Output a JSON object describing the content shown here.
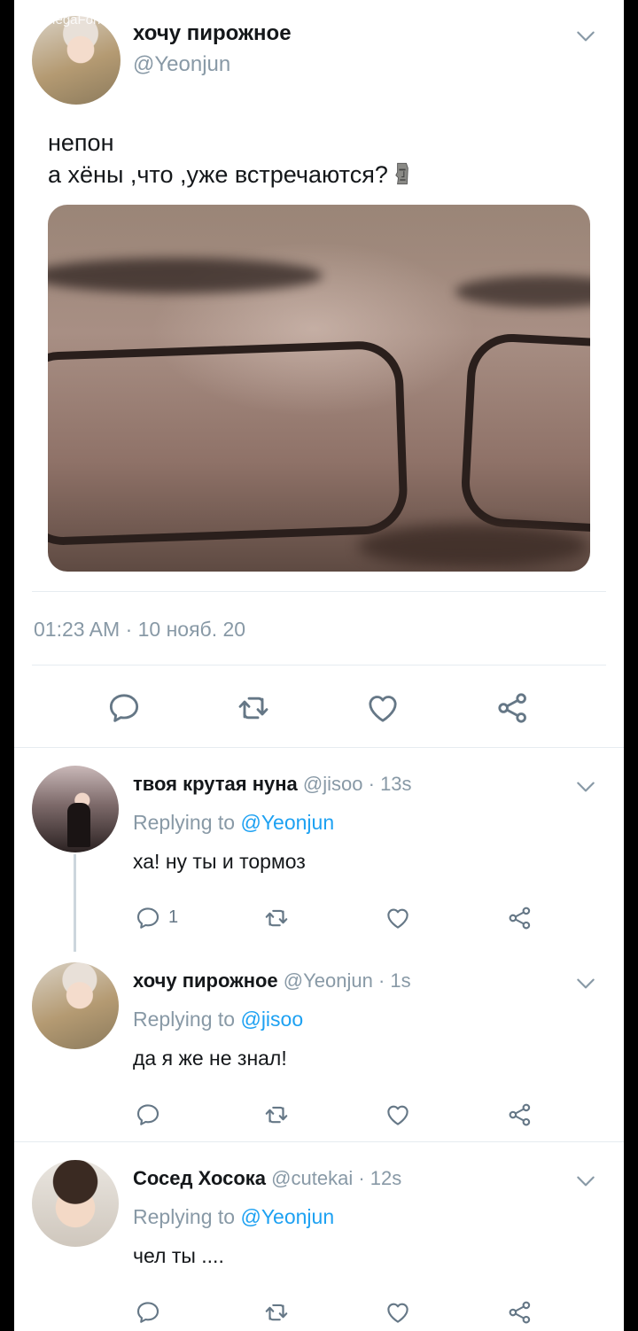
{
  "status_bar": {
    "carrier": "MegaFon"
  },
  "main_tweet": {
    "display_name": "хочу пирожное",
    "handle": "@Yeonjun",
    "text_line1": "непон",
    "text_line2": "а хёны ,что ,уже встречаются?",
    "emoji": "moai",
    "timestamp": "01:23 AM · 10 нояб. 20"
  },
  "replies": [
    {
      "display_name": "твоя крутая нуна",
      "handle": "@jisoo",
      "time": "· 13s",
      "replying_label": "Replying to",
      "replying_to": "@Yeonjun",
      "text": "ха! ну ты и тормоз",
      "reply_count": "1"
    },
    {
      "display_name": "хочу пирожное",
      "handle": "@Yeonjun",
      "time": "· 1s",
      "replying_label": "Replying to",
      "replying_to": "@jisoo",
      "text": "да я же не знал!",
      "reply_count": ""
    },
    {
      "display_name": "Сосед Хосока",
      "handle": "@cutekai",
      "time": "· 12s",
      "replying_label": "Replying to",
      "replying_to": "@Yeonjun",
      "text": "чел ты ....",
      "reply_count": ""
    }
  ],
  "icons": [
    "reply-icon",
    "retweet-icon",
    "like-icon",
    "share-icon",
    "chevron-down-icon"
  ],
  "colors": {
    "link": "#1da1f2",
    "muted": "#8899a6",
    "icon": "#657786",
    "divider": "#e6ecf0"
  }
}
